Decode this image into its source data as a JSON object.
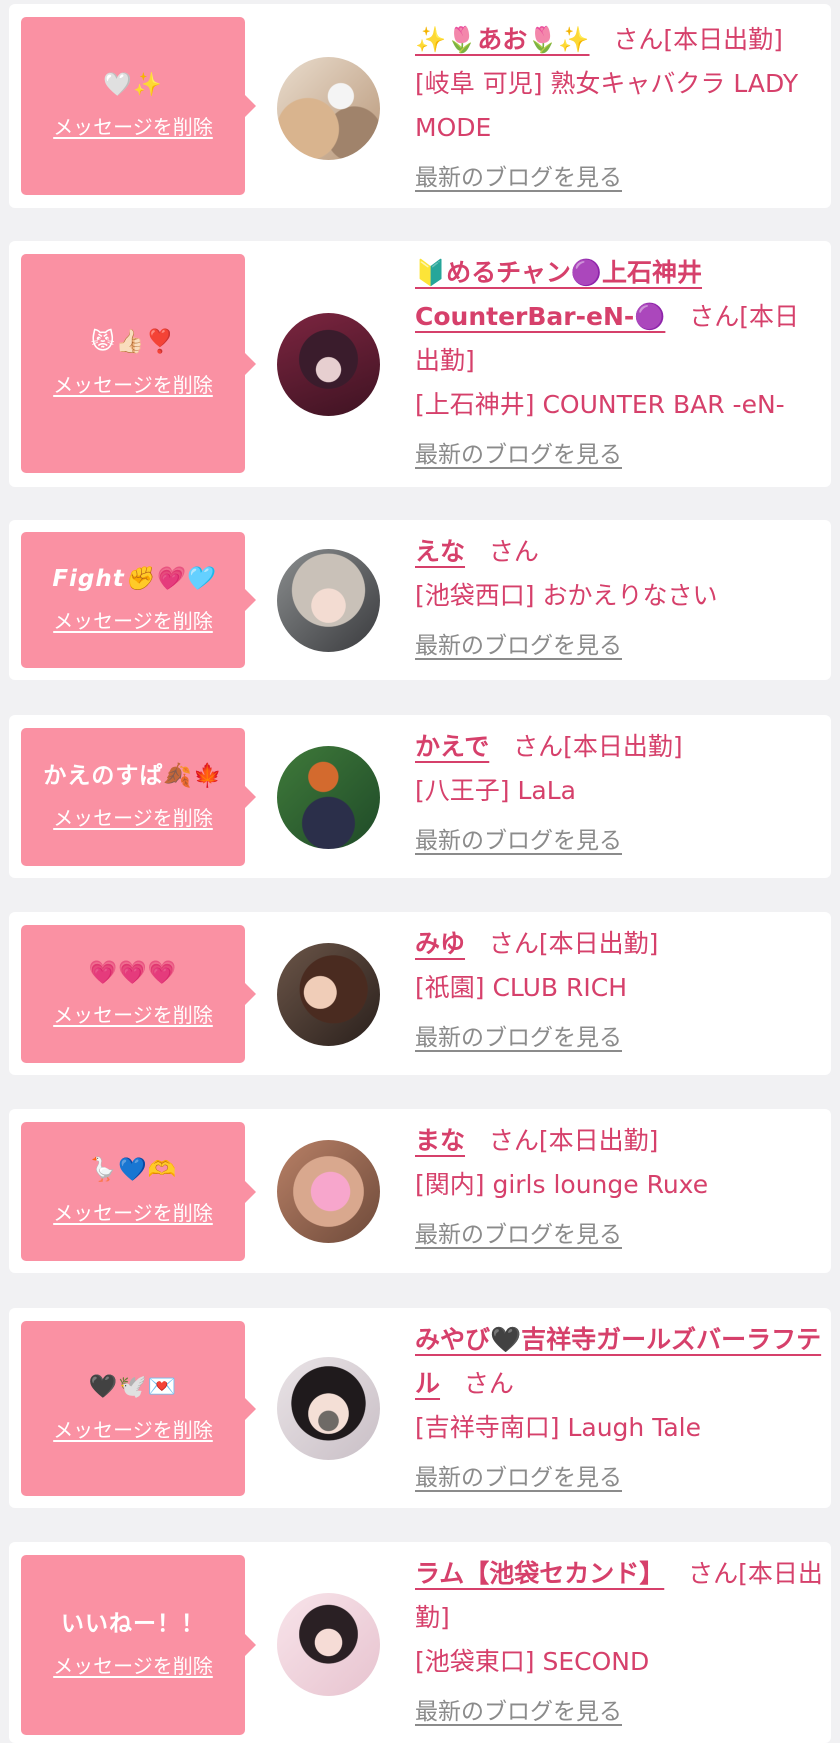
{
  "delete_label": "メッセージを削除",
  "blog_label": "最新のブログを見る",
  "colors": {
    "accent_pink": "#fa91a3",
    "text_pink": "#d6406b",
    "link_gray": "#8b8b8b",
    "background": "#f1f1f3"
  },
  "items": [
    {
      "message": "🤍✨",
      "name": "✨🌷あお🌷✨",
      "san": "さん",
      "status": "[本日出勤]",
      "shop": "[岐阜 可児] 熟女キャバクラ LADY MODE"
    },
    {
      "message": "😾👍🏻❣️",
      "name": "🔰めるチャン🟣上石神井CounterBar-eN-🟣",
      "san": "さん",
      "status": "[本日出勤]",
      "shop": "[上石神井] COUNTER BAR -eN-"
    },
    {
      "message": "Fight✊💗🩵",
      "name": "えな",
      "san": "さん",
      "status": "",
      "shop": "[池袋西口] おかえりなさい"
    },
    {
      "message": "かえのすぱ🍂🍁",
      "name": "かえで",
      "san": "さん",
      "status": "[本日出勤]",
      "shop": "[八王子] LaLa"
    },
    {
      "message": "💗💗💗",
      "name": "みゆ",
      "san": "さん",
      "status": "[本日出勤]",
      "shop": "[祇園] CLUB RICH"
    },
    {
      "message": "🪿💙🫶",
      "name": "まな",
      "san": "さん",
      "status": "[本日出勤]",
      "shop": "[関内] girls lounge Ruxe"
    },
    {
      "message": "🖤🕊️💌",
      "name": "みやび🖤吉祥寺ガールズバーラフテル",
      "san": "さん",
      "status": "",
      "shop": "[吉祥寺南口] Laugh Tale"
    },
    {
      "message": "いいねー！！",
      "name": "ラム【池袋セカンド】",
      "san": "さん",
      "status": "[本日出勤]",
      "shop": "[池袋東口] SECOND"
    }
  ]
}
